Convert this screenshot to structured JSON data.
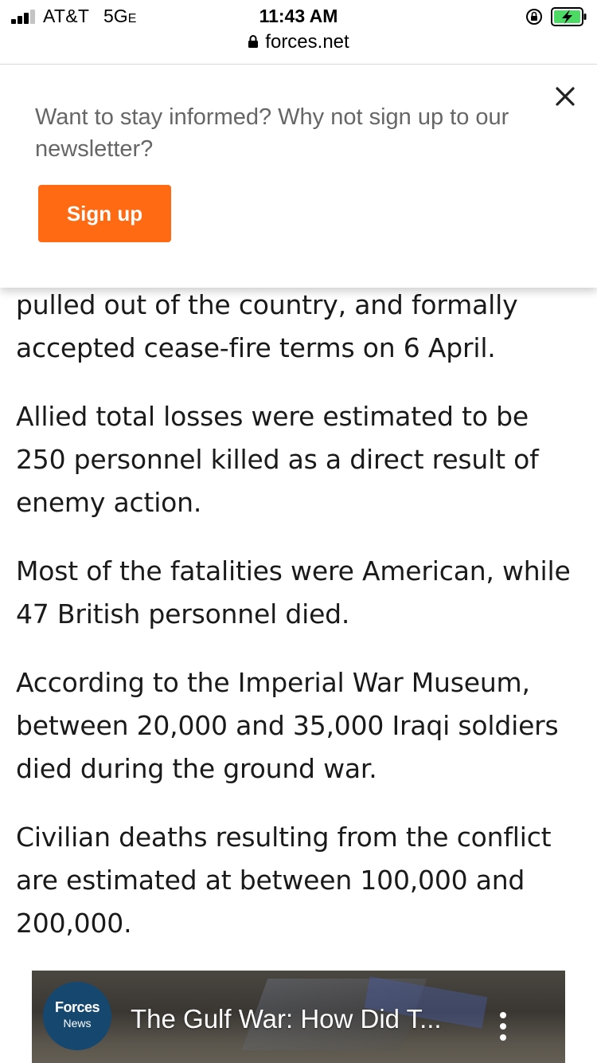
{
  "status_bar": {
    "carrier": "AT&T",
    "network": "5G",
    "network_suffix": "E",
    "time": "11:43 AM",
    "signal_bars": 3,
    "signal_bars_total": 4,
    "battery_charging": true,
    "rotation_lock_icon": "rotation-lock-icon"
  },
  "url_bar": {
    "domain": "forces.net",
    "secure_icon": "lock-icon"
  },
  "newsletter": {
    "message": "Want to stay informed? Why not sign up to our newsletter?",
    "signup_label": "Sign up",
    "close_icon": "close-icon",
    "button_color": "#ff6a13"
  },
  "article": {
    "paragraphs": [
      "pulled out of the country, and formally accepted cease-fire terms on 6 April.",
      "Allied total losses were estimated to be 250 personnel killed as a direct result of enemy action.",
      "Most of the fatalities were American, while 47 British personnel died.",
      "According to the Imperial War Museum, between 20,000 and 35,000 Iraqi soldiers died during the ground war.",
      "Civilian deaths resulting from the conflict are estimated at between 100,000 and 200,000."
    ]
  },
  "video": {
    "channel_logo_main": "Forces",
    "channel_logo_sub": "News",
    "title": "The Gulf War: How Did T...",
    "more_icon": "more-vertical-icon",
    "channel_color": "#16486f"
  }
}
